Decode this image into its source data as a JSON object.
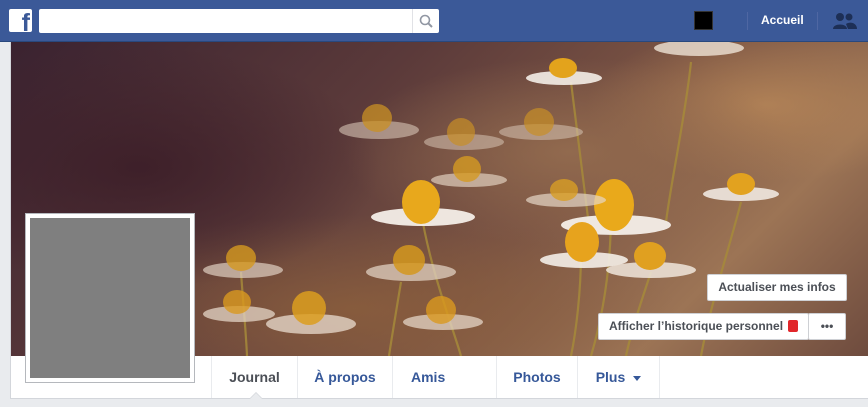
{
  "topbar": {
    "logo_letter": "f",
    "search": {
      "placeholder": "",
      "value": "",
      "icon": "search-icon"
    },
    "home_label": "Accueil",
    "friends_icon": "friends-icon",
    "colors": {
      "bar": "#3b5998"
    }
  },
  "cover": {
    "update_info_label": "Actualiser mes infos",
    "activity_log_label": "Afficher l’historique personnel",
    "more_label": "•••"
  },
  "tabs": [
    {
      "label": "Journal",
      "active": true
    },
    {
      "label": "À propos"
    },
    {
      "label": "Amis"
    },
    {
      "label": "Photos"
    },
    {
      "label": "Plus"
    }
  ],
  "colors": {
    "link": "#365899",
    "active_tab": "#4b4f56",
    "notification": "#e1262a"
  }
}
